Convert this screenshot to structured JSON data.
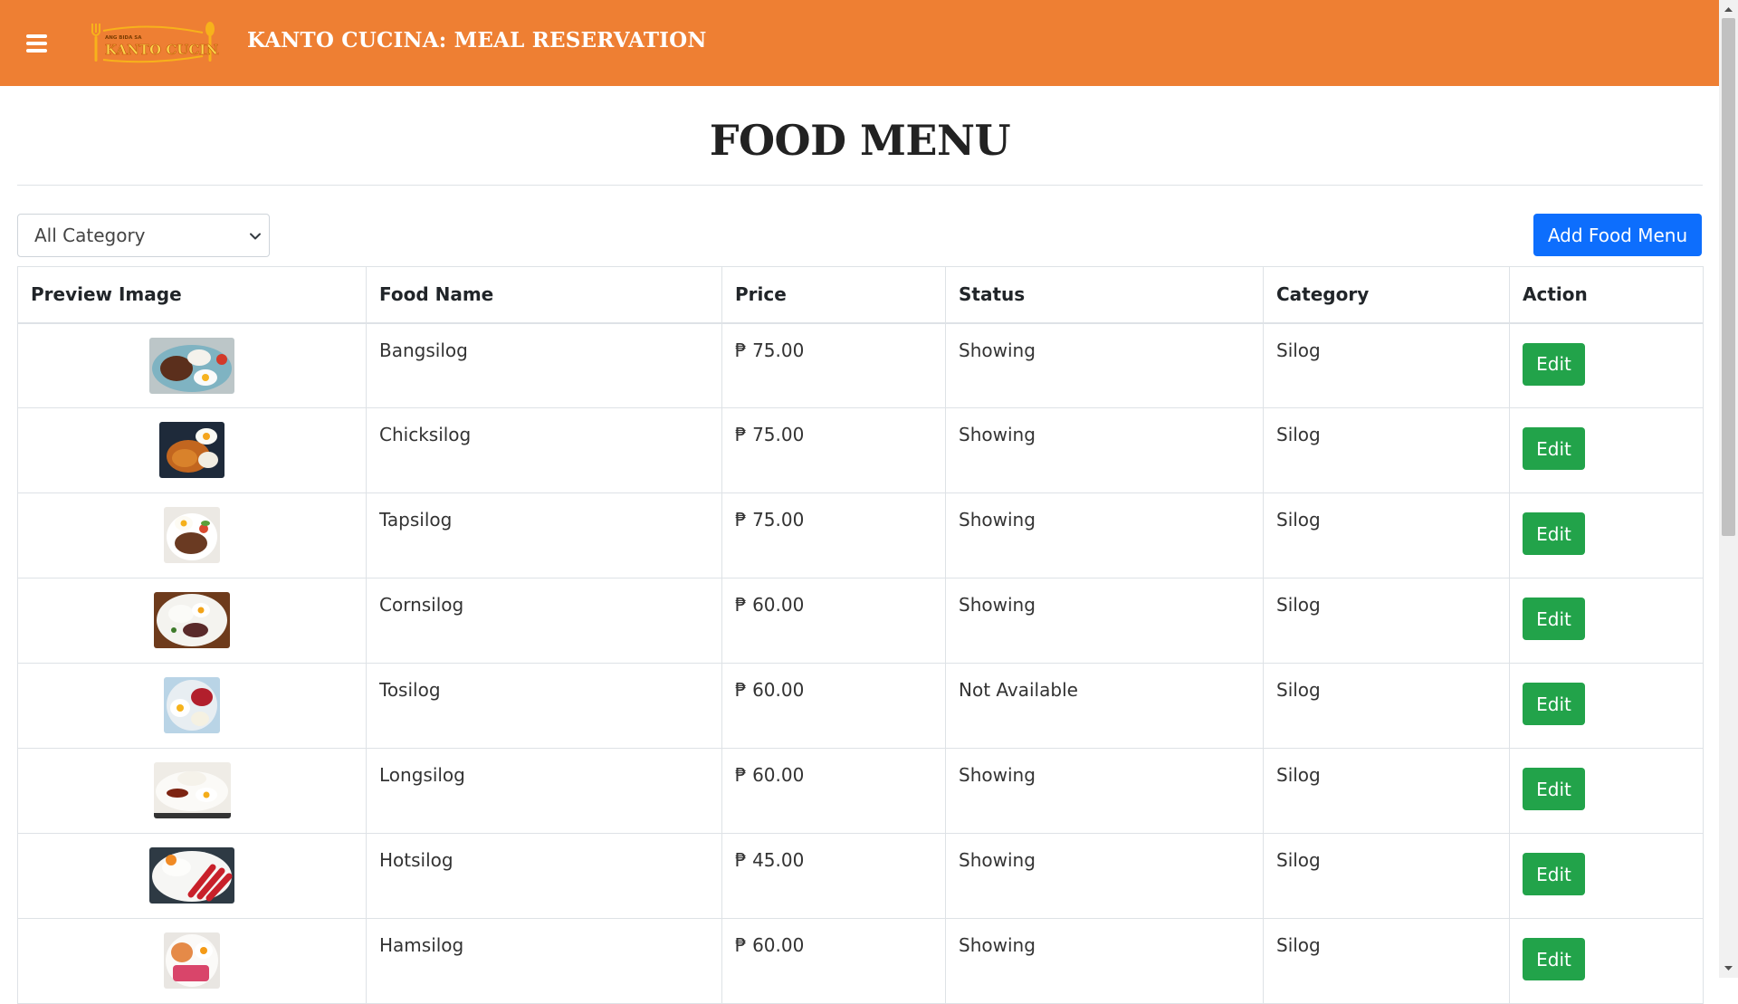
{
  "header": {
    "menu_icon": "hamburger-icon",
    "logo_tagline": "ANG BIDA SA",
    "logo_text": "KANTO CUCINA",
    "title": "KANTO CUCINA: MEAL RESERVATION",
    "color": "#ee7f33"
  },
  "page": {
    "title": "FOOD MENU"
  },
  "filter": {
    "selected": "All Category"
  },
  "actions": {
    "add_label": "Add Food Menu",
    "add_color": "#0d6efd"
  },
  "table": {
    "headers": {
      "image": "Preview Image",
      "name": "Food Name",
      "price": "Price",
      "status": "Status",
      "category": "Category",
      "action": "Action"
    },
    "rows": [
      {
        "name": "Bangsilog",
        "price": "₱ 75.00",
        "status": "Showing",
        "category": "Silog",
        "action": "Edit"
      },
      {
        "name": "Chicksilog",
        "price": "₱ 75.00",
        "status": "Showing",
        "category": "Silog",
        "action": "Edit"
      },
      {
        "name": "Tapsilog",
        "price": "₱ 75.00",
        "status": "Showing",
        "category": "Silog",
        "action": "Edit"
      },
      {
        "name": "Cornsilog",
        "price": "₱ 60.00",
        "status": "Showing",
        "category": "Silog",
        "action": "Edit"
      },
      {
        "name": "Tosilog",
        "price": "₱ 60.00",
        "status": "Not Available",
        "category": "Silog",
        "action": "Edit"
      },
      {
        "name": "Longsilog",
        "price": "₱ 60.00",
        "status": "Showing",
        "category": "Silog",
        "action": "Edit"
      },
      {
        "name": "Hotsilog",
        "price": "₱ 45.00",
        "status": "Showing",
        "category": "Silog",
        "action": "Edit"
      },
      {
        "name": "Hamsilog",
        "price": "₱ 60.00",
        "status": "Showing",
        "category": "Silog",
        "action": "Edit"
      }
    ],
    "edit_color": "#22a34a"
  }
}
